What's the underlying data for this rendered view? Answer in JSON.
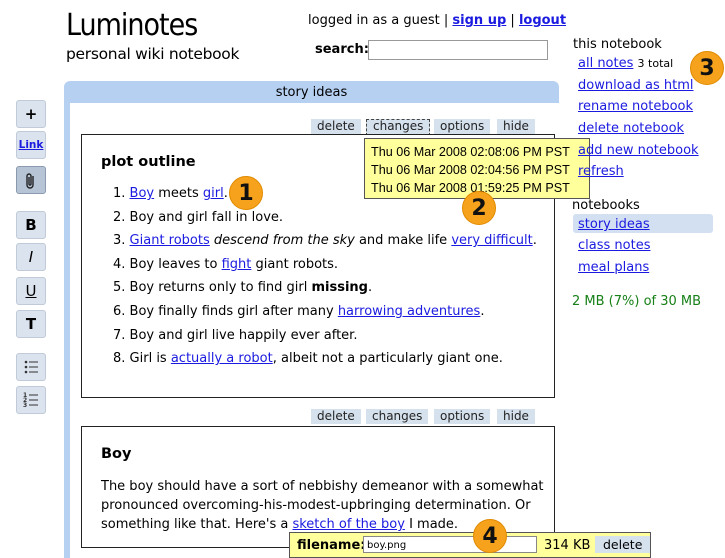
{
  "header": {
    "title": "Luminotes",
    "subtitle": "personal wiki notebook",
    "login_text": "logged in as a guest |",
    "signup": "sign up",
    "sep": "|",
    "logout": "logout",
    "search_label": "search:",
    "search_value": ""
  },
  "toolbar": {
    "plus": "+",
    "link": "Link",
    "attach_icon": "paperclip-icon",
    "bold": "B",
    "italic": "I",
    "underline": "U",
    "title": "T",
    "bullet_icon": "bullet-list-icon",
    "number_icon": "numbered-list-icon"
  },
  "notes": {
    "header_title": "story ideas",
    "controls": {
      "delete": "delete",
      "changes": "changes",
      "options": "options",
      "hide": "hide"
    },
    "note1": {
      "title": "plot outline",
      "items": [
        {
          "num": "1.",
          "link1": "Boy",
          "t1": " meets ",
          "link2": "girl",
          "t2": "."
        },
        {
          "num": "2.",
          "text": "Boy and girl fall in love."
        },
        {
          "num": "3.",
          "link1": "Giant robots",
          "em": " descend from the sky",
          "t1": " and make life ",
          "link2": "very difficult",
          "t2": "."
        },
        {
          "num": "4.",
          "t0": "Boy leaves to ",
          "link1": "fight",
          "t1": " giant robots."
        },
        {
          "num": "5.",
          "t0": "Boy returns only to find girl ",
          "bold": "missing",
          "t1": "."
        },
        {
          "num": "6.",
          "t0": "Boy finally finds girl after many ",
          "link1": "harrowing adventures",
          "t1": "."
        },
        {
          "num": "7.",
          "text": "Boy and girl live happily ever after."
        },
        {
          "num": "8.",
          "t0": "Girl is ",
          "link1": "actually a robot",
          "t1": ", albeit not a particularly giant one."
        }
      ]
    },
    "note2": {
      "title": "Boy",
      "p1": "The boy should have a sort of nebbishy demeanor with a somewhat",
      "p2": "pronounced overcoming-his-modest-upbringing determination. Or",
      "p3_pre": "something like that. Here's a ",
      "p3_link": "sketch of the boy",
      "p3_post": " I made."
    }
  },
  "tooltip": {
    "lines": [
      "Thu 06 Mar 2008 02:08:06 PM PST",
      "Thu 06 Mar 2008 02:04:56 PM PST",
      "Thu 06 Mar 2008 01:59:25 PM PST"
    ]
  },
  "filebar": {
    "label": "filename:",
    "value": "boy.png",
    "size": "314 KB",
    "delete": "delete"
  },
  "sidebar": {
    "this_notebook": "this notebook",
    "all_notes": "all notes",
    "total": "3 total",
    "links": [
      "download as html",
      "rename notebook",
      "delete notebook",
      "add new notebook",
      "refresh"
    ],
    "notebooks_head": "notebooks",
    "notebooks": [
      "story ideas",
      "class notes",
      "meal plans"
    ],
    "storage": "2 MB (7%) of 30 MB"
  },
  "callouts": [
    "1",
    "2",
    "3",
    "4"
  ],
  "colors": {
    "accent_blue": "#b6d0f2",
    "tooltip_yellow": "#ffff9c",
    "callout_orange": "#f6a21c",
    "storage_green": "#178017",
    "link_blue": "#1a1ae0"
  }
}
